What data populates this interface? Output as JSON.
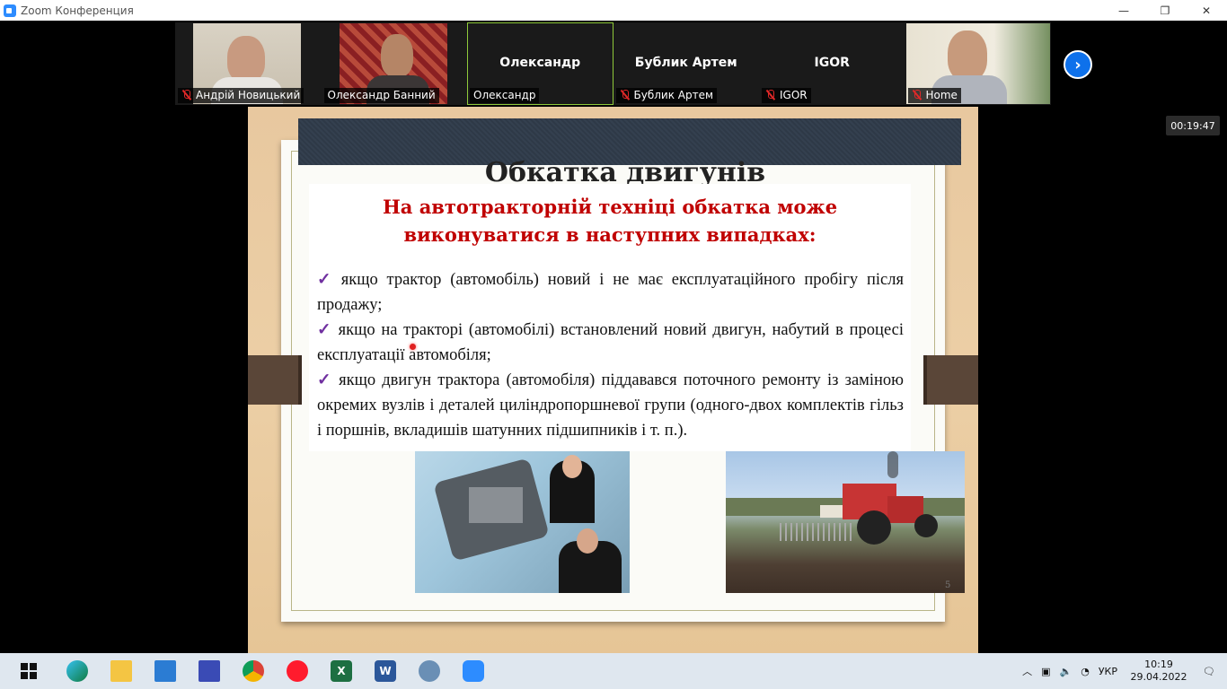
{
  "window": {
    "title": "Zoom Конференция",
    "controls": {
      "minimize": "—",
      "restore": "❐",
      "close": "✕"
    }
  },
  "gallery": {
    "participants": [
      {
        "label": "Андрій Новицький",
        "muted": true,
        "video": true
      },
      {
        "label": "Олександр Банний",
        "muted": false,
        "video": true
      },
      {
        "label": "Олександр",
        "center_name": "Олександр",
        "muted": false,
        "video": false,
        "active": true
      },
      {
        "label": "Бублик Артем",
        "center_name": "Бублик Артем",
        "muted": true,
        "video": false
      },
      {
        "label": "IGOR",
        "center_name": "IGOR",
        "muted": true,
        "video": false
      },
      {
        "label": "Home",
        "muted": true,
        "video": true
      }
    ],
    "next_icon": "chevron-right-icon"
  },
  "timer": "00:19:47",
  "slide": {
    "title": "Обкатка двигунів",
    "subtitle_line1": "На автотракторній техніці обкатка може",
    "subtitle_line2": "виконуватися в наступних випадках:",
    "bullets": [
      "якщо трактор (автомобіль) новий і не має експлуатаційного пробігу після продажу;",
      "якщо на тракторі (автомобілі) встановлений новий двигун, набутий в процесі експлуатації автомобіля;",
      "якщо двигун трактора (автомобіля) піддавався поточного ремонту із заміною окремих вузлів і деталей циліндропоршневої групи (одного-двох комплектів гільз і поршнів, вкладишів шатунних підшипників і т. п.)."
    ],
    "check_mark": "✓",
    "slide_number": "5",
    "colors": {
      "subtitle": "#c00000",
      "check": "#7030a0"
    }
  },
  "taskbar": {
    "apps": [
      "edge",
      "file-explorer",
      "mail",
      "save",
      "chrome",
      "opera",
      "excel",
      "word",
      "search-tool",
      "zoom"
    ],
    "language": "УКР",
    "time": "10:19",
    "date": "29.04.2022"
  }
}
